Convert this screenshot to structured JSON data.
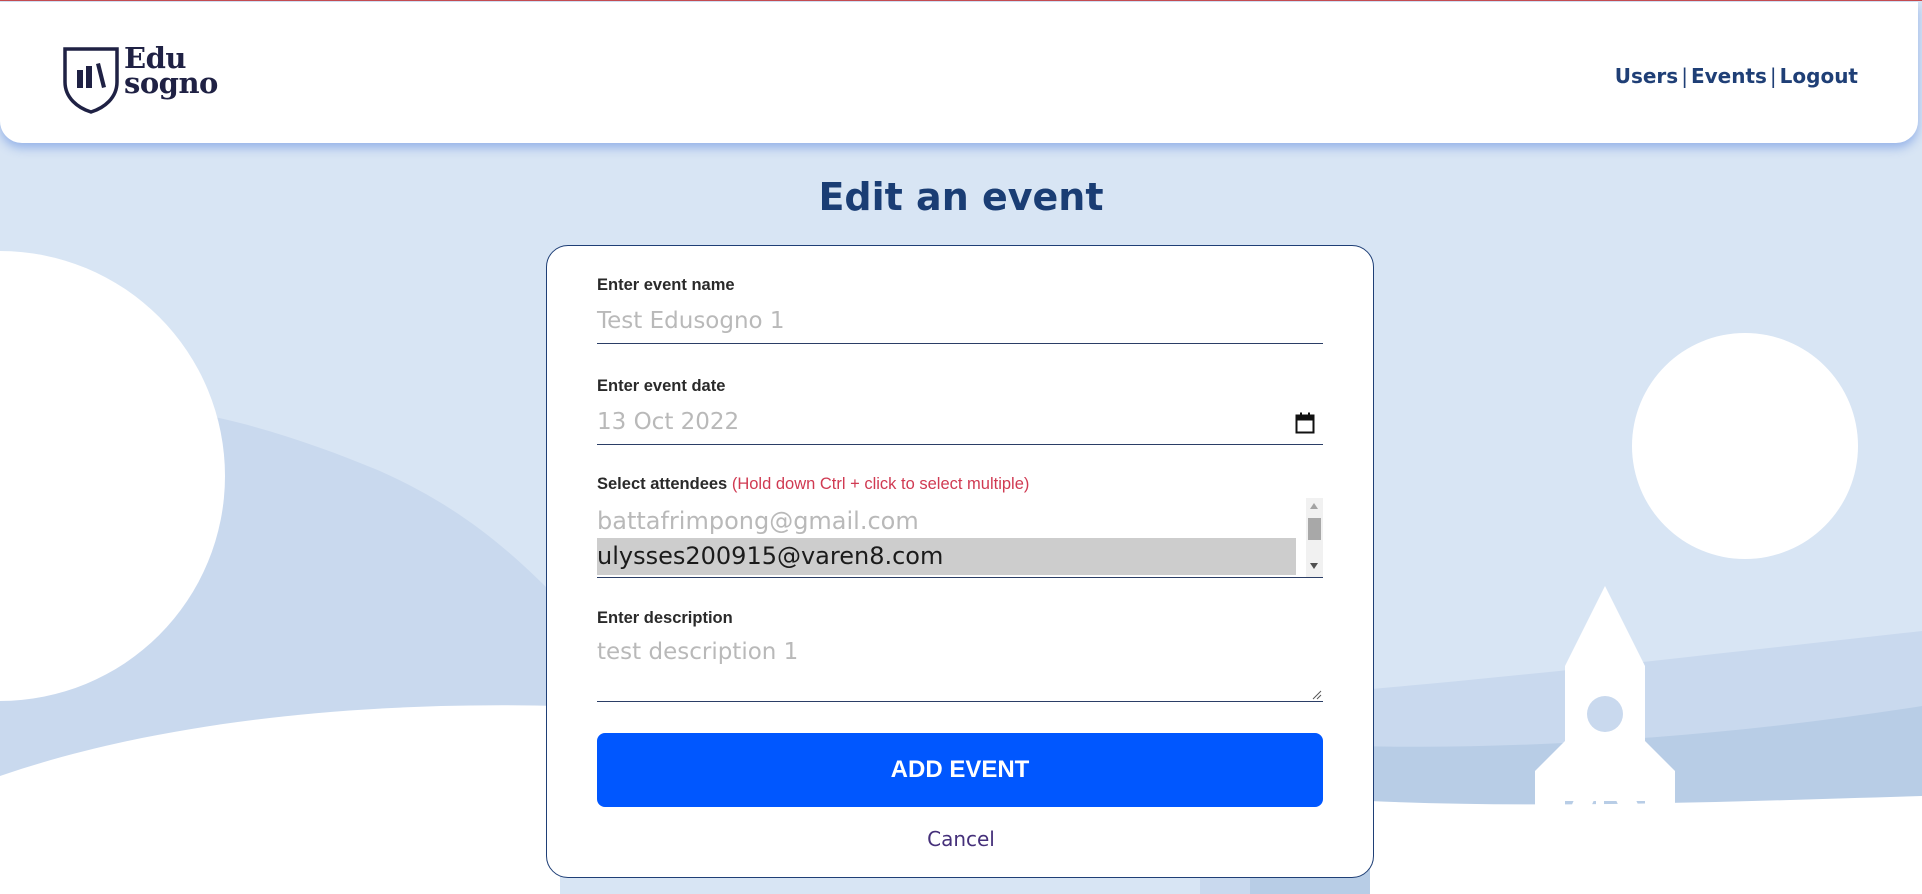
{
  "brand": {
    "line1": "Edu",
    "line2": "sogno"
  },
  "nav": {
    "users": "Users",
    "events": "Events",
    "logout": "Logout",
    "separator": "|"
  },
  "page": {
    "title": "Edit an event"
  },
  "form": {
    "name_label": "Enter event name",
    "name_value": "Test Edusogno 1",
    "date_label": "Enter event date",
    "date_value": "13 Oct 2022",
    "attendees_label": "Select attendees",
    "attendees_hint": "(Hold down Ctrl + click to select multiple)",
    "attendees": [
      {
        "email": "battafrimpong@gmail.com",
        "selected": false
      },
      {
        "email": "ulysses200915@varen8.com",
        "selected": true
      }
    ],
    "description_label": "Enter description",
    "description_value": "test description 1",
    "submit_label": "ADD EVENT",
    "cancel_label": "Cancel"
  },
  "colors": {
    "background": "#d8e5f4",
    "primary_button": "#0057ff",
    "heading": "#1a3d74",
    "hint": "#d03a52"
  },
  "icons": [
    "shield-books-logo",
    "calendar-icon"
  ]
}
